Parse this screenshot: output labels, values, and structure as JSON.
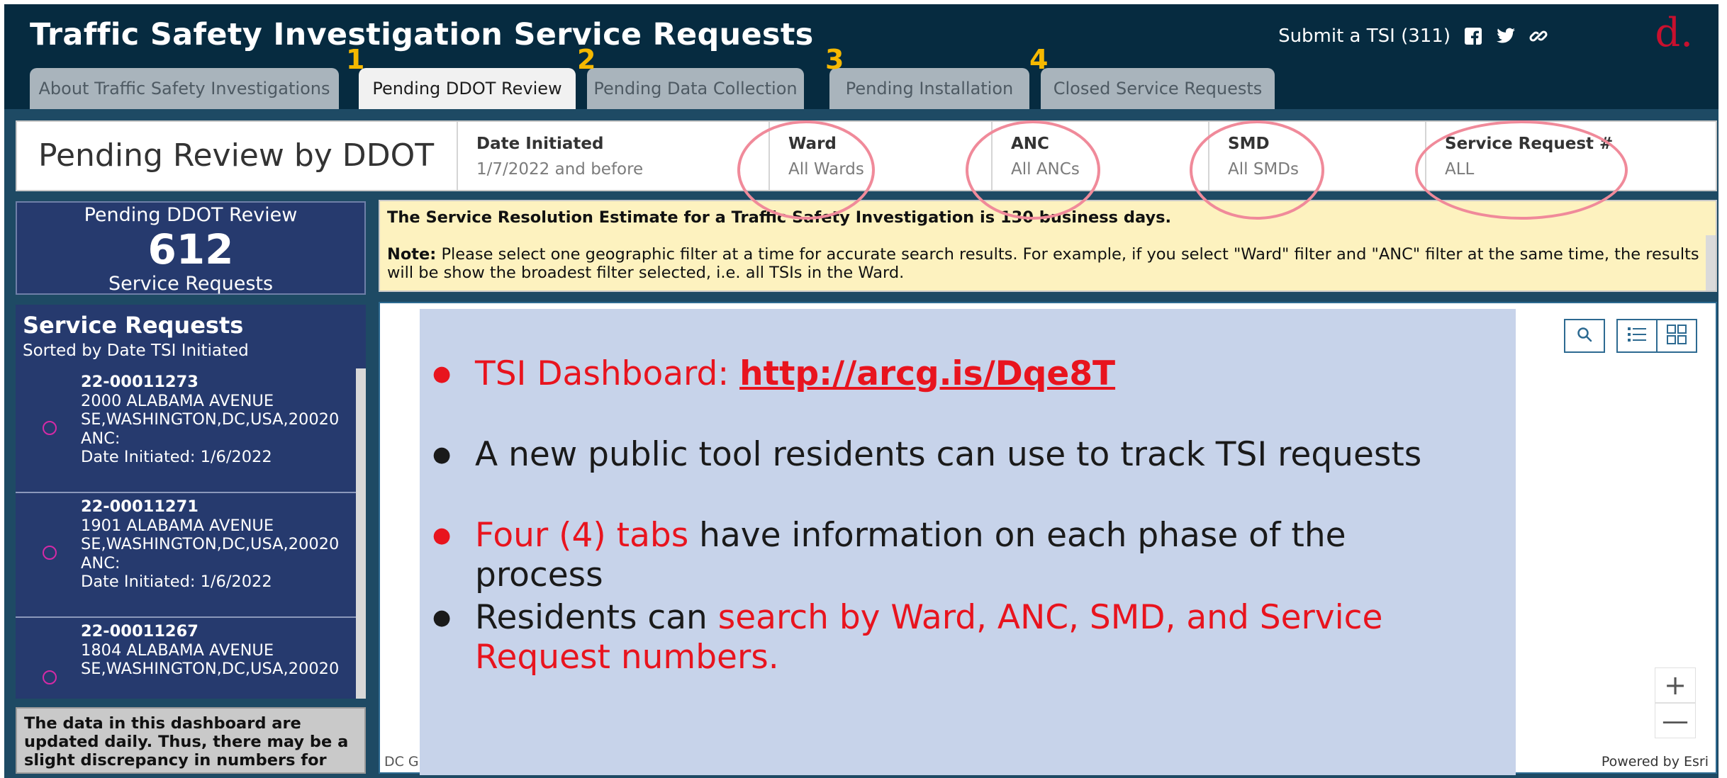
{
  "header": {
    "title": "Traffic Safety Investigation Service Requests",
    "submit_link": "Submit a TSI (311)",
    "logo": "d."
  },
  "tabs": [
    {
      "label": "About Traffic Safety Investigations",
      "number": ""
    },
    {
      "label": "Pending DDOT Review",
      "number": "1",
      "active": true
    },
    {
      "label": "Pending Data Collection",
      "number": "2"
    },
    {
      "label": "Pending Installation",
      "number": "3"
    },
    {
      "label": "Closed Service Requests",
      "number": "4"
    }
  ],
  "filters": {
    "title": "Pending Review by DDOT",
    "items": [
      {
        "label": "Date Initiated",
        "value": "1/7/2022 and before"
      },
      {
        "label": "Ward",
        "value": "All Wards"
      },
      {
        "label": "ANC",
        "value": "All ANCs"
      },
      {
        "label": "SMD",
        "value": "All SMDs"
      },
      {
        "label": "Service Request #",
        "value": "ALL"
      }
    ]
  },
  "summary": {
    "label": "Pending DDOT Review",
    "count": "612",
    "unit": "Service Requests"
  },
  "list": {
    "title": "Service Requests",
    "subtitle": "Sorted by Date TSI Initiated",
    "items": [
      {
        "id": "22-00011273",
        "address": "2000 ALABAMA AVENUE SE,WASHINGTON,DC,USA,20020",
        "anc": "ANC:",
        "date": "Date Initiated: 1/6/2022"
      },
      {
        "id": "22-00011271",
        "address": "1901 ALABAMA AVENUE SE,WASHINGTON,DC,USA,20020",
        "anc": "ANC:",
        "date": "Date Initiated: 1/6/2022"
      },
      {
        "id": "22-00011267",
        "address": "1804 ALABAMA AVENUE SE,WASHINGTON,DC,USA,20020",
        "anc": "",
        "date": ""
      }
    ]
  },
  "disclaimer": "The data in this dashboard are updated daily. Thus, there may be a slight discrepancy in numbers for any",
  "notice": {
    "line1": "The Service Resolution Estimate for a Traffic Safety Investigation is 130 business days.",
    "note_label": "Note:",
    "note_text": " Please select one geographic filter at a time for accurate search results. For example, if you select \"Ward\" filter and \"ANC\" filter at the same time, the results will be show the broadest filter selected, i.e. all TSIs in the Ward."
  },
  "slide": {
    "b1_prefix": "TSI Dashboard: ",
    "b1_link": "http://arcg.is/Dqe8T",
    "b2": "A new public tool residents can use to track TSI requests",
    "b3_red": "Four (4) tabs",
    "b3_rest": " have information on each phase of the process",
    "b4_prefix": "Residents can ",
    "b4_red": "search by Ward, ANC, SMD, and Service Request numbers."
  },
  "map": {
    "dc_credit": "DC G",
    "esri_credit": "Powered by Esri",
    "zoom_in": "+",
    "zoom_out": "—"
  },
  "colors": {
    "header_bg": "#062b40",
    "tab_number": "#f5b800",
    "panel_navy": "#263a6e",
    "slide_bg": "#c7d3ea",
    "highlight_red": "#e8141e",
    "annotation_pink": "#f08a9a",
    "logo_red": "#c8102e"
  },
  "icons": [
    "facebook-icon",
    "twitter-icon",
    "link-icon",
    "search-icon",
    "list-icon",
    "grid-icon"
  ]
}
